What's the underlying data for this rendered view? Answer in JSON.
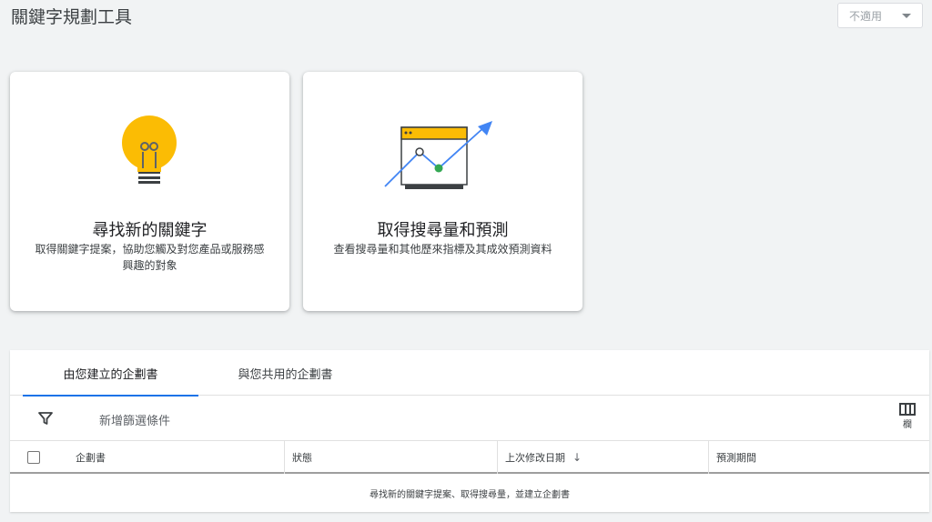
{
  "header": {
    "title": "關鍵字規劃工具",
    "account_select": "不適用"
  },
  "cards": [
    {
      "title": "尋找新的關鍵字",
      "description": "取得關鍵字提案，協助您觸及對您產品或服務感興趣的對象"
    },
    {
      "title": "取得搜尋量和預測",
      "description": "查看搜尋量和其他歷來指標及其成效預測資料"
    }
  ],
  "tabs": [
    {
      "label": "由您建立的企劃書",
      "active": true
    },
    {
      "label": "與您共用的企劃書",
      "active": false
    }
  ],
  "filter": {
    "label": "新增篩選條件"
  },
  "columns_button": {
    "label": "欄"
  },
  "table": {
    "headers": [
      "企劃書",
      "狀態",
      "上次修改日期",
      "預測期間"
    ],
    "sort_arrow": "↓",
    "empty_message": "尋找新的關鍵字提案、取得搜尋量，並建立企劃書"
  },
  "colors": {
    "accent": "#1a73e8",
    "bulb": "#fbbc04",
    "chart_dot": "#34a853"
  }
}
